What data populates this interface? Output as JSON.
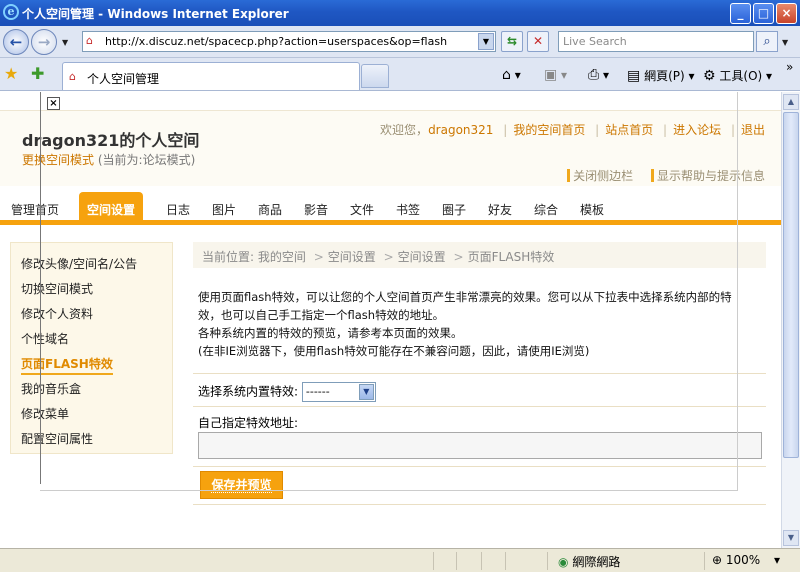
{
  "window": {
    "title": "个人空间管理 - Windows Internet Explorer",
    "controls": [
      "_",
      "□",
      "×"
    ]
  },
  "toolbar": {
    "url": "http://x.discuz.net/spacecp.php?action=userspaces&op=flash",
    "search_placeholder": "Live Search",
    "tab_label": "个人空间管理",
    "page_menu": "網頁(P)",
    "tools_menu": "工具(O)"
  },
  "page": {
    "close_mark": "×",
    "site_title": "dragon321的个人空间",
    "mode_link": "更换空间模式",
    "mode_note": "(当前为:论坛模式)",
    "top_links": {
      "welcome": "欢迎您，",
      "username": "dragon321",
      "my_space": "我的空间首页",
      "site_home": "站点首页",
      "forum": "进入论坛",
      "logout": "退出"
    },
    "tool_links": [
      "关闭侧边栏",
      "显示帮助与提示信息"
    ],
    "nav": [
      "管理首页",
      "空间设置",
      "日志",
      "图片",
      "商品",
      "影音",
      "文件",
      "书签",
      "圈子",
      "好友",
      "综合",
      "模板"
    ],
    "nav_active_index": 1,
    "sidebar": [
      "修改头像/空间名/公告",
      "切换空间模式",
      "修改个人资料",
      "个性域名",
      "页面FLASH特效",
      "我的音乐盒",
      "修改菜单",
      "配置空间属性"
    ],
    "sidebar_active_index": 4,
    "breadcrumb": {
      "prefix": "当前位置: 我的空间",
      "items": [
        "空间设置",
        "空间设置",
        "页面FLASH特效"
      ]
    },
    "description": [
      "使用页面flash特效，可以让您的个人空间首页产生非常漂亮的效果。您可以从下拉表中选择系统内部的特",
      "效，也可以自己手工指定一个flash特效的地址。",
      "各种系统内置的特效的预览，请参考本页面的效果。",
      "(在非IE浏览器下，使用flash特效可能存在不兼容问题，因此，请使用IE浏览)"
    ],
    "select_label": "选择系统内置特效:",
    "select_value": "------",
    "custom_label": "自己指定特效地址:",
    "custom_value": "",
    "save_button": "保存并预览"
  },
  "statusbar": {
    "zone": "網際網路",
    "zoom": "100%"
  },
  "colors": {
    "accent": "#f6a20e",
    "link": "#cc7700",
    "titlebar": "#1f57c3"
  }
}
